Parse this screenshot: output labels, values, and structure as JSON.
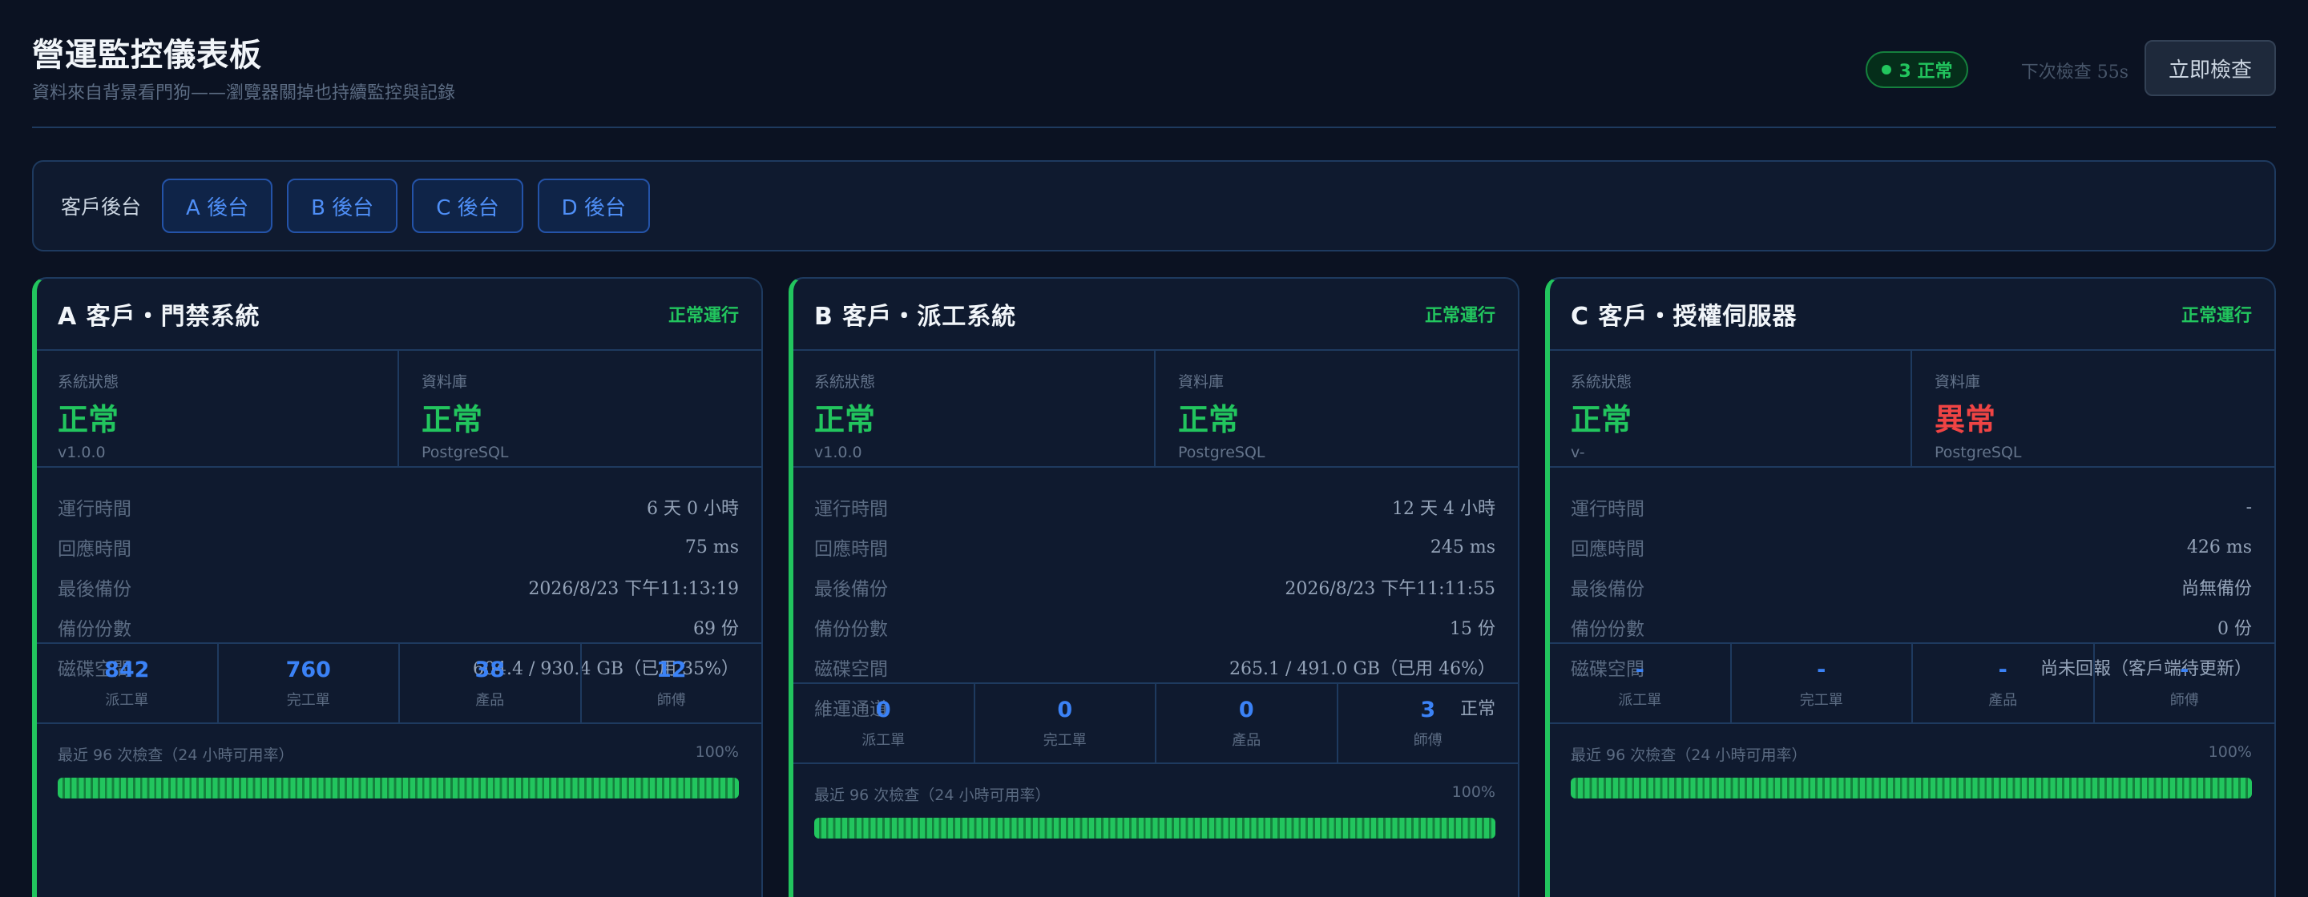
{
  "header": {
    "title": "營運監控儀表板",
    "subtitle": "資料來自背景看門狗——瀏覽器關掉也持續監控與記錄",
    "status_badge": "3 正常",
    "next_check": "下次檢查 55s",
    "check_now_label": "立即檢查"
  },
  "tabs": {
    "label": "客戶後台",
    "items": [
      "A 後台",
      "B 後台",
      "C 後台",
      "D 後台"
    ]
  },
  "colors": {
    "ok": "#22c55e",
    "bad": "#ef4444",
    "accent": "#3b82f6"
  },
  "cards": [
    {
      "title": "A 客戶・門禁系統",
      "state": "正常運行",
      "system": {
        "label": "系統狀態",
        "value": "正常",
        "sub": "v1.0.0",
        "status": "ok"
      },
      "database": {
        "label": "資料庫",
        "value": "正常",
        "sub": "PostgreSQL",
        "status": "ok"
      },
      "metrics": [
        {
          "key": "運行時間",
          "value": "6 天 0 小時"
        },
        {
          "key": "回應時間",
          "value": "75 ms"
        },
        {
          "key": "最後備份",
          "value": "2026/8/23 下午11:13:19"
        },
        {
          "key": "備份份數",
          "value": "69 份"
        },
        {
          "key": "磁碟空間",
          "value": "604.4 / 930.4 GB（已用 35%）"
        }
      ],
      "counts": [
        {
          "value": "842",
          "label": "派工單"
        },
        {
          "value": "760",
          "label": "完工單"
        },
        {
          "value": "38",
          "label": "產品"
        },
        {
          "value": "12",
          "label": "師傅"
        }
      ],
      "availability": {
        "label": "最近 96 次檢查（24 小時可用率）",
        "value": "100%",
        "fraction": 1.0
      }
    },
    {
      "title": "B 客戶・派工系統",
      "state": "正常運行",
      "system": {
        "label": "系統狀態",
        "value": "正常",
        "sub": "v1.0.0",
        "status": "ok"
      },
      "database": {
        "label": "資料庫",
        "value": "正常",
        "sub": "PostgreSQL",
        "status": "ok"
      },
      "metrics": [
        {
          "key": "運行時間",
          "value": "12 天 4 小時"
        },
        {
          "key": "回應時間",
          "value": "245 ms"
        },
        {
          "key": "最後備份",
          "value": "2026/8/23 下午11:11:55"
        },
        {
          "key": "備份份數",
          "value": "15 份"
        },
        {
          "key": "磁碟空間",
          "value": "265.1 / 491.0 GB（已用 46%）"
        },
        {
          "key": "維運通道",
          "value": "正常"
        }
      ],
      "counts": [
        {
          "value": "0",
          "label": "派工單"
        },
        {
          "value": "0",
          "label": "完工單"
        },
        {
          "value": "0",
          "label": "產品"
        },
        {
          "value": "3",
          "label": "師傅"
        }
      ],
      "availability": {
        "label": "最近 96 次檢查（24 小時可用率）",
        "value": "100%",
        "fraction": 1.0
      }
    },
    {
      "title": "C 客戶・授權伺服器",
      "state": "正常運行",
      "system": {
        "label": "系統狀態",
        "value": "正常",
        "sub": "v-",
        "status": "ok"
      },
      "database": {
        "label": "資料庫",
        "value": "異常",
        "sub": "PostgreSQL",
        "status": "bad"
      },
      "metrics": [
        {
          "key": "運行時間",
          "value": "-"
        },
        {
          "key": "回應時間",
          "value": "426 ms"
        },
        {
          "key": "最後備份",
          "value": "尚無備份"
        },
        {
          "key": "備份份數",
          "value": "0 份"
        },
        {
          "key": "磁碟空間",
          "value": "尚未回報（客戶端待更新）"
        }
      ],
      "counts": [
        {
          "value": "-",
          "label": "派工單"
        },
        {
          "value": "-",
          "label": "完工單"
        },
        {
          "value": "-",
          "label": "產品"
        },
        {
          "value": "-",
          "label": "師傅"
        }
      ],
      "availability": {
        "label": "最近 96 次檢查（24 小時可用率）",
        "value": "100%",
        "fraction": 1.0
      }
    }
  ]
}
